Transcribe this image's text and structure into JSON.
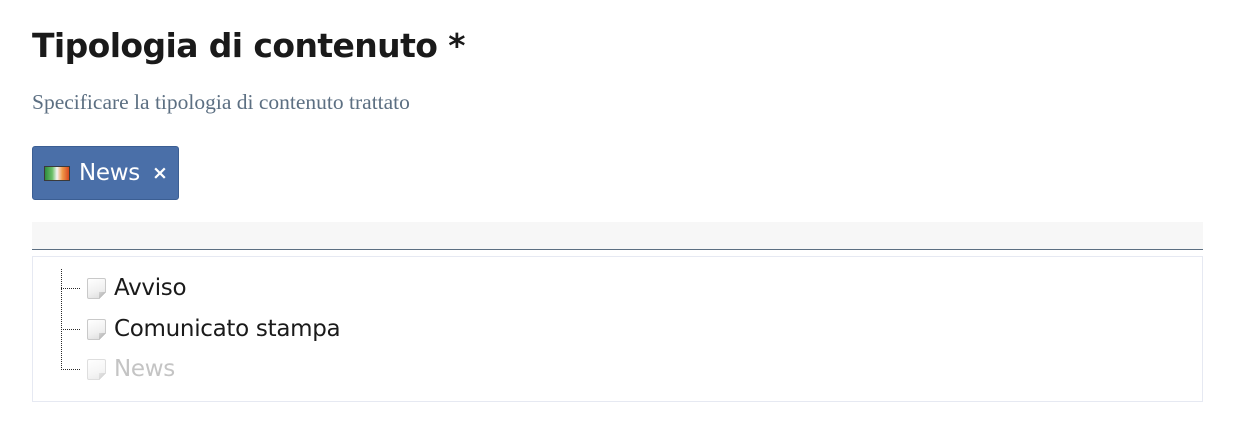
{
  "field": {
    "title": "Tipologia di contenuto *",
    "help_text": "Specificare la tipologia di contenuto trattato"
  },
  "selected": [
    {
      "label": "News",
      "icon": "flag-icon",
      "remove_label": "×"
    }
  ],
  "tree": {
    "items": [
      {
        "label": "Avviso",
        "icon": "document-icon",
        "disabled": false
      },
      {
        "label": "Comunicato stampa",
        "icon": "document-icon",
        "disabled": false
      },
      {
        "label": "News",
        "icon": "document-icon",
        "disabled": true
      }
    ]
  },
  "colors": {
    "chip_background": "#4a6fa8",
    "help_text": "#5c6f82",
    "disabled_text": "#c4c4c4"
  }
}
